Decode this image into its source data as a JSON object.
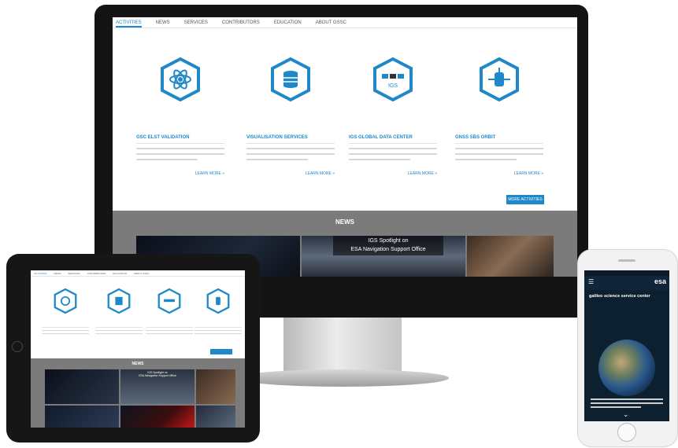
{
  "desktop": {
    "nav": [
      "ACTIVITIES",
      "NEWS",
      "SERVICES",
      "CONTRIBUTORS",
      "EDUCATION",
      "ABOUT GSSC"
    ],
    "cards": [
      {
        "title": "GSC ELST VALIDATION",
        "link": "LEARN MORE »",
        "icon": "atom-icon"
      },
      {
        "title": "VISUALISATION SERVICES",
        "link": "LEARN MORE »",
        "icon": "database-icon"
      },
      {
        "title": "IGS GLOBAL DATA CENTER",
        "link": "LEARN MORE »",
        "icon": "igs-satellite-icon",
        "icon_text": "IGS"
      },
      {
        "title": "GNSS SBS ORBIT",
        "link": "LEARN MORE »",
        "icon": "satellite-icon"
      }
    ],
    "more_button": "MORE ACTIVITIES",
    "news_title": "NEWS",
    "news_caption_line1": "IGS Spotlight on",
    "news_caption_line2": "ESA Navigation Support Office"
  },
  "tablet": {
    "nav": [
      "ACTIVITIES",
      "NEWS",
      "SERVICES",
      "CONTRIBUTORS",
      "EDUCATION",
      "ABOUT GSSC"
    ],
    "news_title": "NEWS",
    "caption_line1": "IGS Spotlight on",
    "caption_line2": "ESA Navigation Support Office"
  },
  "phone": {
    "logo": "esa",
    "heading": "galileo science service center",
    "chevron": "⌄"
  },
  "colors": {
    "accent": "#1e88c9",
    "band": "#7b7b7b",
    "bezel": "#141414"
  }
}
